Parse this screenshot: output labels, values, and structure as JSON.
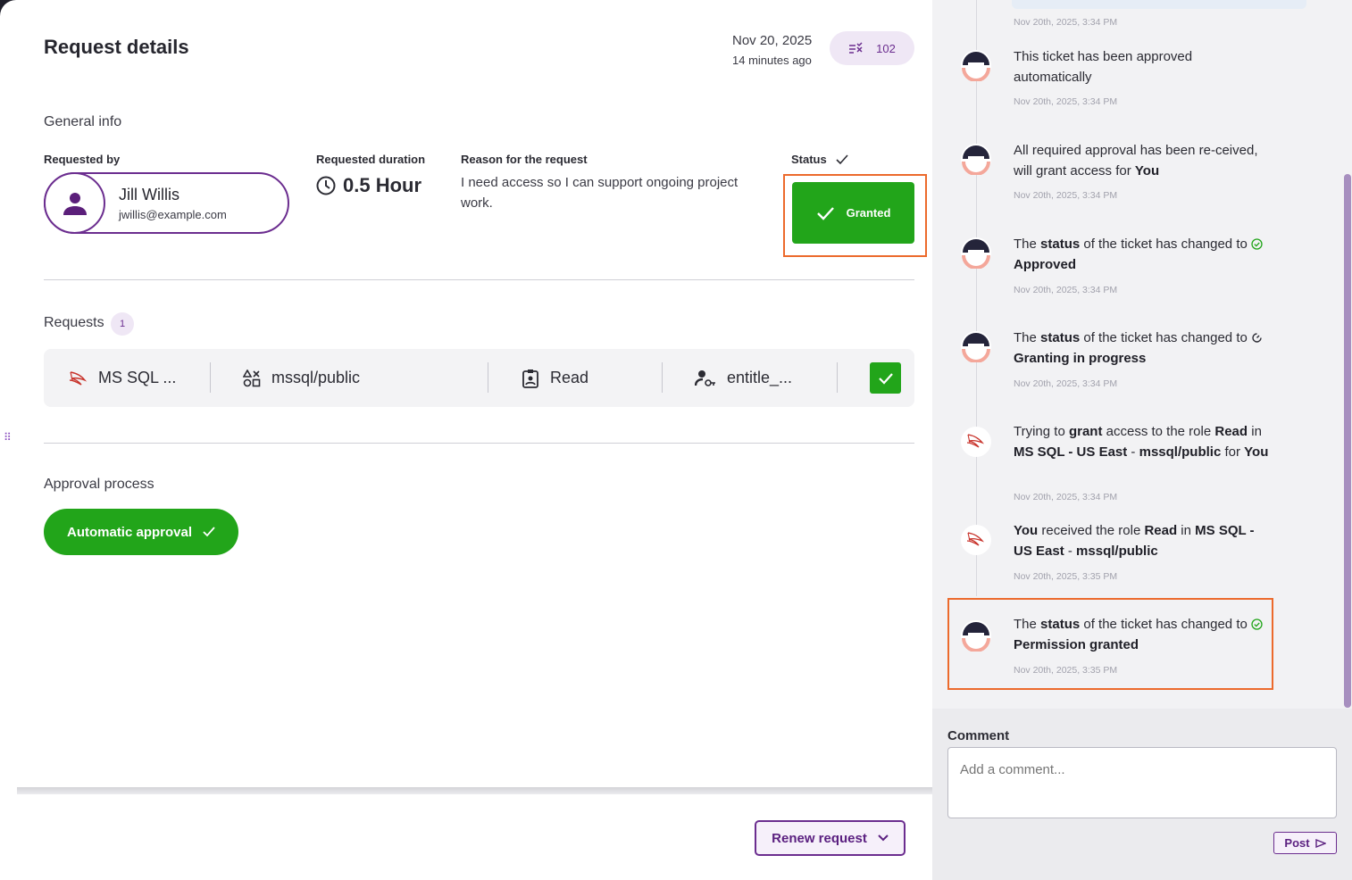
{
  "header": {
    "title": "Request details",
    "date": "Nov 20, 2025",
    "relative_time": "14 minutes ago",
    "ticket_number": "102"
  },
  "general_info": {
    "section_title": "General info",
    "requested_by_label": "Requested by",
    "requester_name": "Jill Willis",
    "requester_email": "jwillis@example.com",
    "duration_label": "Requested duration",
    "duration_value": "0.5 Hour",
    "reason_label": "Reason for the request",
    "reason_text": "I need access so I can support ongoing project work.",
    "status_label": "Status",
    "status_value": "Granted"
  },
  "requests": {
    "section_title": "Requests",
    "count": "1",
    "row": {
      "integration": "MS SQL ...",
      "resource": "mssql/public",
      "role": "Read",
      "entitlement": "entitle_..."
    }
  },
  "approval": {
    "section_title": "Approval process",
    "pill_label": "Automatic approval"
  },
  "footer": {
    "renew_label": "Renew request"
  },
  "timeline": {
    "top_time": "Nov 20th, 2025, 3:34 PM",
    "events": [
      {
        "parts": [
          "This ticket has been approved automatically"
        ],
        "time": "Nov 20th, 2025, 3:34 PM"
      },
      {
        "parts": [
          "All required approval has been re-ceived, will grant access for ",
          "You"
        ],
        "time": "Nov 20th, 2025, 3:34 PM"
      },
      {
        "parts": [
          "The ",
          "status",
          " of the ticket has changed to ",
          "Approved"
        ],
        "time": "Nov 20th, 2025, 3:34 PM"
      },
      {
        "parts": [
          "The ",
          "status",
          " of the ticket has changed to ",
          "Granting in progress"
        ],
        "time": "Nov 20th, 2025, 3:34 PM"
      },
      {
        "parts": [
          "Trying to ",
          "grant",
          " access to the role ",
          "Read",
          " in ",
          "MS SQL - US East",
          " - ",
          "mssql/public",
          " for ",
          "You"
        ],
        "time": "Nov 20th, 2025, 3:34 PM"
      },
      {
        "parts": [
          "You",
          " received the role ",
          "Read",
          " in ",
          "MS SQL - US East",
          " - ",
          "mssql/public"
        ],
        "time": "Nov 20th, 2025, 3:35 PM"
      },
      {
        "parts": [
          "The ",
          "status",
          " of the ticket has changed to ",
          "Permission granted"
        ],
        "time": "Nov 20th, 2025, 3:35 PM"
      }
    ]
  },
  "comment": {
    "label": "Comment",
    "placeholder": "Add a comment...",
    "post_label": "Post"
  },
  "colors": {
    "brand_purple": "#6b2d8f",
    "success_green": "#22a51a",
    "highlight_orange": "#ec6a2c"
  }
}
